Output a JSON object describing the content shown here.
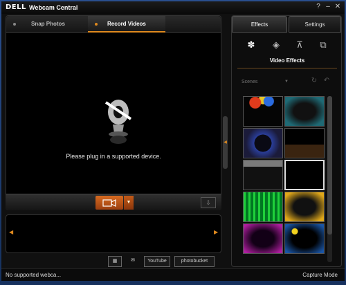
{
  "window": {
    "logo": "DELL",
    "title": "Webcam Central",
    "help": "?",
    "minimize": "–",
    "close": "✕"
  },
  "tabs": {
    "snap_photos": "Snap Photos",
    "record_videos": "Record Videos"
  },
  "preview": {
    "message": "Please plug in a supported device."
  },
  "share": {
    "youtube": "YouTube",
    "photobucket": "photobucket"
  },
  "status": {
    "left": "No supported webca...",
    "right": "Capture Mode"
  },
  "right_panel": {
    "tabs": {
      "effects": "Effects",
      "settings": "Settings"
    },
    "section_title": "Video Effects",
    "scenes_label": "Scenes",
    "icons": [
      "palette-icon",
      "shield-icon",
      "presentation-icon",
      "window-icon"
    ]
  },
  "colors": {
    "accent": "#e08a1e",
    "window_frame": "#2a4f8f"
  }
}
